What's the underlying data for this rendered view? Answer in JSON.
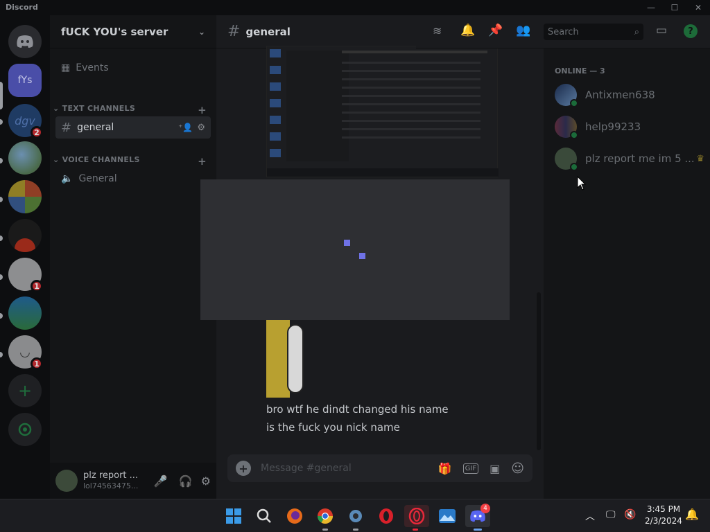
{
  "window": {
    "app_name": "Discord",
    "min": "—",
    "max": "☐",
    "close": "✕"
  },
  "guilds": [
    {
      "name": "fYs",
      "badge": ""
    },
    {
      "name": "dgv",
      "badge": "2"
    },
    {
      "name": "",
      "badge": ""
    },
    {
      "name": "",
      "badge": ""
    },
    {
      "name": "",
      "badge": ""
    },
    {
      "name": "",
      "badge": "1"
    },
    {
      "name": "",
      "badge": ""
    },
    {
      "name": "",
      "badge": "1"
    }
  ],
  "server": {
    "name": "fUCK YOU's server",
    "events_label": "Events",
    "text_category": "TEXT CHANNELS",
    "voice_category": "VOICE CHANNELS",
    "text_channel": "general",
    "voice_channel": "General"
  },
  "user_panel": {
    "display_name": "plz report ...",
    "username": "lol74563475..."
  },
  "chat": {
    "channel_name": "general",
    "search_placeholder": "Search",
    "messages": [
      "bro wtf he dindt changed his name",
      "is the fuck you nick name"
    ],
    "input_placeholder": "Message #general"
  },
  "members": {
    "header": "ONLINE — 3",
    "list": [
      {
        "name": "Antixmen638"
      },
      {
        "name": "help99233"
      },
      {
        "name": "plz report me im 5 ..."
      }
    ]
  },
  "taskbar": {
    "time": "3:45 PM",
    "date": "2/3/2024",
    "discord_badge": "4"
  },
  "colors": {
    "accent": "#5865f2",
    "online": "#23a55a",
    "badge": "#f23f43"
  }
}
